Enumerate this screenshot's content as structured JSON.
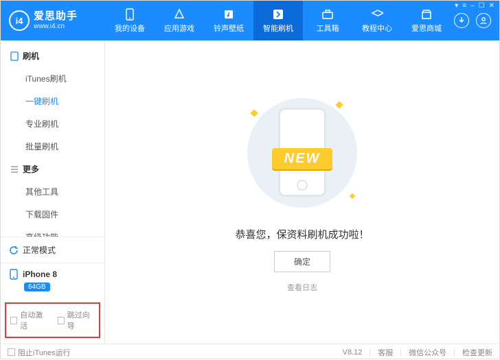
{
  "app": {
    "logo_badge": "i4",
    "name": "爱思助手",
    "site": "www.i4.cn"
  },
  "nav": [
    {
      "label": "我的设备",
      "icon": "device"
    },
    {
      "label": "应用游戏",
      "icon": "apps"
    },
    {
      "label": "铃声壁纸",
      "icon": "music"
    },
    {
      "label": "智能刷机",
      "icon": "flash",
      "active": true
    },
    {
      "label": "工具箱",
      "icon": "toolbox"
    },
    {
      "label": "教程中心",
      "icon": "edu"
    },
    {
      "label": "爱思商城",
      "icon": "shop"
    }
  ],
  "sidebar": {
    "group1": {
      "title": "刷机",
      "items": [
        "iTunes刷机",
        "一键刷机",
        "专业刷机",
        "批量刷机"
      ],
      "selected": 1
    },
    "group2": {
      "title": "更多",
      "items": [
        "其他工具",
        "下载固件",
        "高级功能"
      ]
    },
    "mode": {
      "label": "正常模式"
    },
    "device": {
      "name": "iPhone 8",
      "storage": "64GB"
    },
    "options": {
      "auto_activate": "自动激活",
      "skip_guide": "跳过向导"
    }
  },
  "main": {
    "ribbon": "NEW",
    "message": "恭喜您，保资料刷机成功啦！",
    "ok": "确定",
    "view_log": "查看日志"
  },
  "footer": {
    "block_itunes": "阻止iTunes运行",
    "version": "V8.12",
    "support": "客服",
    "wechat": "微信公众号",
    "update": "检查更新"
  },
  "sysbar": {
    "a": "▾",
    "b": "≡",
    "c": "–",
    "d": "☐",
    "e": "✕"
  }
}
